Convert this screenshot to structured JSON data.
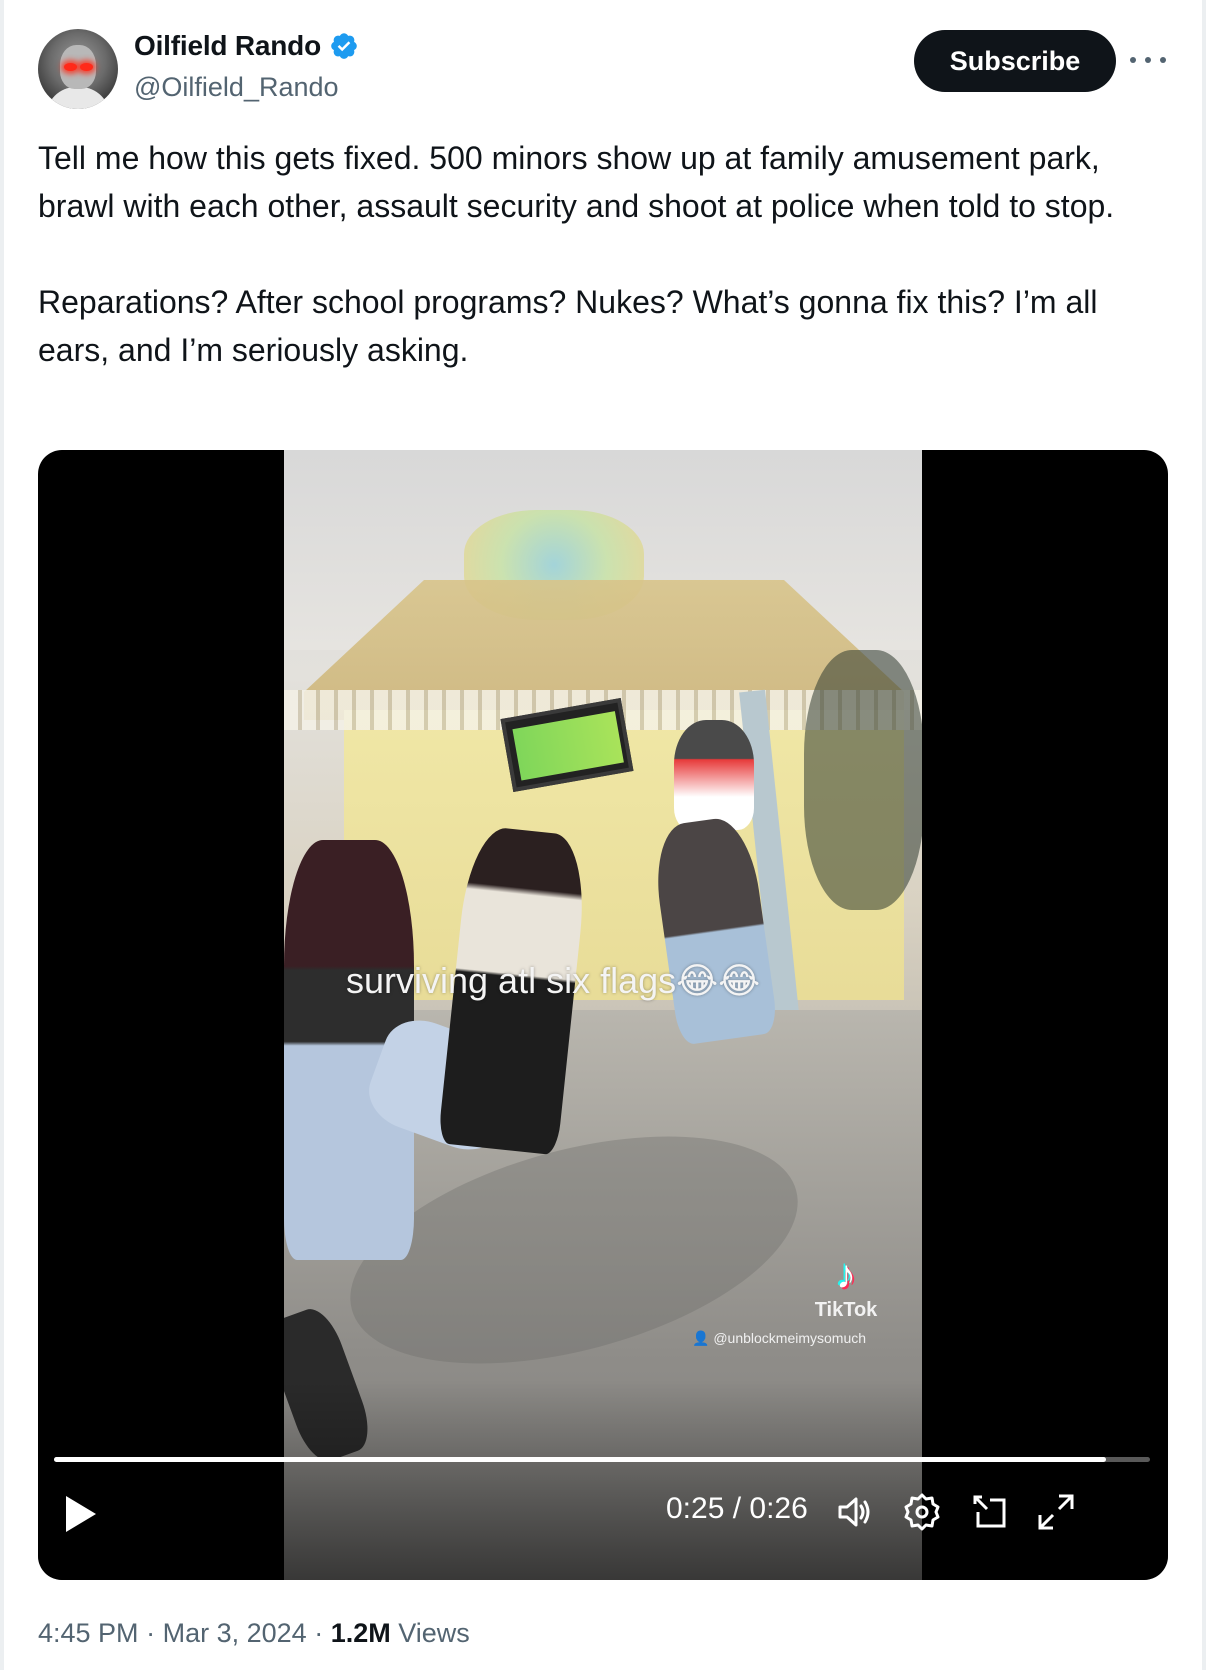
{
  "author": {
    "display_name": "Oilfield Rando",
    "handle": "@Oilfield_Rando",
    "verified": true,
    "verified_color": "#1d9bf0"
  },
  "actions": {
    "subscribe_label": "Subscribe",
    "more_icon": "more-horizontal-icon"
  },
  "tweet": {
    "paragraphs": [
      "Tell me how this gets fixed. 500 minors show up at family amusement park, brawl with each other, assault security and shoot at police when told to stop.",
      "Reparations? After school programs? Nukes? What’s gonna fix this? I’m all ears, and I’m seriously asking."
    ]
  },
  "video": {
    "caption": "surviving atl six flags😂😂",
    "watermark_brand": "TikTok",
    "watermark_user": "@unblockmeimysomuch",
    "time_display": "0:25 / 0:26",
    "progress_fraction": 0.96,
    "controls": [
      "play-icon",
      "volume-icon",
      "settings-gear-icon",
      "pop-out-icon",
      "fullscreen-icon"
    ]
  },
  "footer": {
    "time": "4:45 PM",
    "separator": "·",
    "date": "Mar 3, 2024",
    "views_count": "1.2M",
    "views_label": "Views"
  }
}
